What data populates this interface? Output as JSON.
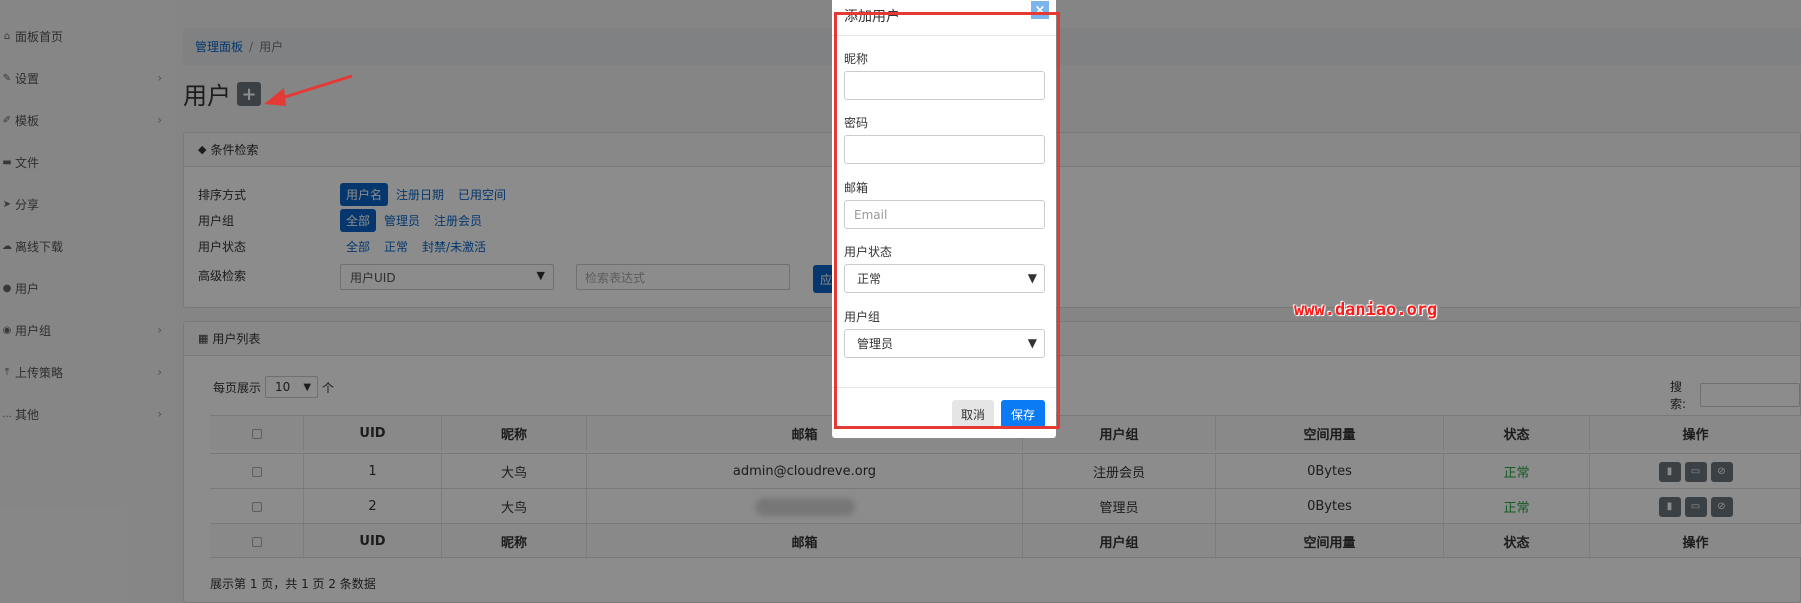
{
  "sidebar": {
    "items": [
      {
        "label": "面板首页",
        "icon": "dashboard-icon",
        "chevron": false
      },
      {
        "label": "设置",
        "icon": "wrench-icon",
        "chevron": true
      },
      {
        "label": "模板",
        "icon": "brush-icon",
        "chevron": true
      },
      {
        "label": "文件",
        "icon": "folder-icon",
        "chevron": false
      },
      {
        "label": "分享",
        "icon": "send-icon",
        "chevron": false
      },
      {
        "label": "离线下载",
        "icon": "cloud-download-icon",
        "chevron": false
      },
      {
        "label": "用户",
        "icon": "user-icon",
        "chevron": false
      },
      {
        "label": "用户组",
        "icon": "users-icon",
        "chevron": true
      },
      {
        "label": "上传策略",
        "icon": "upload-icon",
        "chevron": true
      },
      {
        "label": "其他",
        "icon": "ellipsis-icon",
        "chevron": true
      }
    ]
  },
  "breadcrumb": {
    "home": "管理面板",
    "sep": "/",
    "current": "用户"
  },
  "page": {
    "title": "用户",
    "add_glyph": "+"
  },
  "filter": {
    "header": "条件检索",
    "sort_label": "排序方式",
    "sort_options": [
      "用户名",
      "注册日期",
      "已用空间"
    ],
    "group_label": "用户组",
    "group_options": [
      "全部",
      "管理员",
      "注册会员"
    ],
    "status_label": "用户状态",
    "status_options": [
      "全部",
      "正常",
      "封禁/未激活"
    ],
    "advanced_label": "高级检索",
    "advanced_select": "用户UID",
    "expression_placeholder": "检索表达式",
    "apply_label": "应"
  },
  "userlist": {
    "header": "用户列表",
    "per_page_label": "每页展示",
    "per_page_value": "10",
    "per_page_unit": "个",
    "search_label": "搜索:",
    "columns": [
      "UID",
      "昵称",
      "邮箱",
      "用户组",
      "空间用量",
      "状态",
      "操作"
    ],
    "rows": [
      {
        "uid": "1",
        "nick": "大鸟",
        "email": "admin@cloudreve.org",
        "group": "注册会员",
        "usage": "0Bytes",
        "status": "正常"
      },
      {
        "uid": "2",
        "nick": "大鸟",
        "email": "",
        "group": "管理员",
        "usage": "0Bytes",
        "status": "正常"
      }
    ],
    "footer_text": "展示第 1 页，共 1 页 2 条数据"
  },
  "modal": {
    "title": "添加用户",
    "close_glyph": "×",
    "nickname_label": "昵称",
    "nickname_value": "",
    "password_label": "密码",
    "password_value": "",
    "email_label": "邮箱",
    "email_placeholder": "Email",
    "status_label": "用户状态",
    "status_value": "正常",
    "group_label": "用户组",
    "group_value": "管理员",
    "cancel_label": "取消",
    "save_label": "保存"
  },
  "watermark": "www.daniao.org",
  "colors": {
    "primary": "#0a64c8",
    "success": "#28a745",
    "highlight": "#e53935"
  }
}
